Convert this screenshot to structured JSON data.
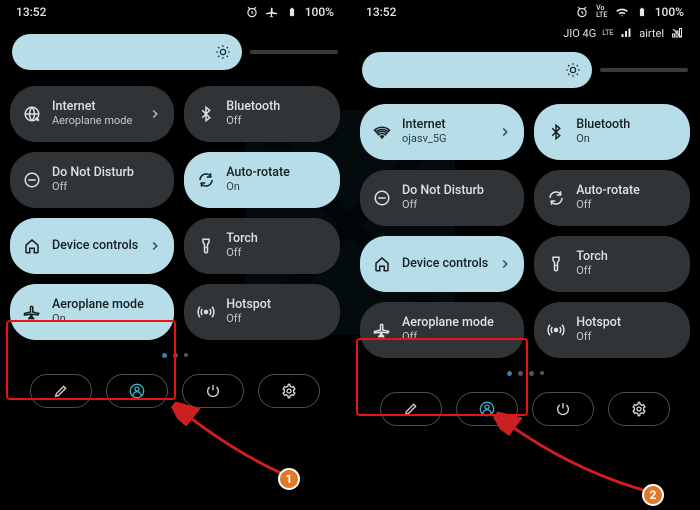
{
  "colors": {
    "tile_on": "#b6dde8",
    "tile_off": "#303437",
    "accent": "#33b5cc",
    "highlight": "#e11",
    "badge": "#e07a2a"
  },
  "left": {
    "status": {
      "time": "13:52",
      "battery": "100%"
    },
    "tiles": [
      {
        "icon": "globe",
        "label": "Internet",
        "sub": "Aeroplane mode",
        "state": "off",
        "chev": true
      },
      {
        "icon": "bluetooth",
        "label": "Bluetooth",
        "sub": "Off",
        "state": "off",
        "chev": false
      },
      {
        "icon": "dnd",
        "label": "Do Not Disturb",
        "sub": "Off",
        "state": "off",
        "chev": false
      },
      {
        "icon": "rotate",
        "label": "Auto-rotate",
        "sub": "On",
        "state": "on",
        "chev": false
      },
      {
        "icon": "home",
        "label": "Device controls",
        "sub": "",
        "state": "on",
        "chev": true
      },
      {
        "icon": "torch",
        "label": "Torch",
        "sub": "Off",
        "state": "off",
        "chev": false
      },
      {
        "icon": "plane",
        "label": "Aeroplane mode",
        "sub": "On",
        "state": "on",
        "chev": false
      },
      {
        "icon": "hotspot",
        "label": "Hotspot",
        "sub": "Off",
        "state": "off",
        "chev": false
      }
    ],
    "badge": "1"
  },
  "right": {
    "status": {
      "time": "13:52",
      "battery": "100%"
    },
    "carrier": {
      "left_net": "JIO 4G",
      "lte": "LTE",
      "right_net": "airtel"
    },
    "tiles": [
      {
        "icon": "wifi",
        "label": "Internet",
        "sub": "ojasv_5G",
        "state": "on",
        "chev": true
      },
      {
        "icon": "bluetooth",
        "label": "Bluetooth",
        "sub": "On",
        "state": "on",
        "chev": false
      },
      {
        "icon": "dnd",
        "label": "Do Not Disturb",
        "sub": "Off",
        "state": "off",
        "chev": false
      },
      {
        "icon": "rotate",
        "label": "Auto-rotate",
        "sub": "Off",
        "state": "off",
        "chev": false
      },
      {
        "icon": "home",
        "label": "Device controls",
        "sub": "",
        "state": "on",
        "chev": true
      },
      {
        "icon": "torch",
        "label": "Torch",
        "sub": "Off",
        "state": "off",
        "chev": false
      },
      {
        "icon": "plane",
        "label": "Aeroplane mode",
        "sub": "Off",
        "state": "off",
        "chev": false
      },
      {
        "icon": "hotspot",
        "label": "Hotspot",
        "sub": "Off",
        "state": "off",
        "chev": false
      }
    ],
    "badge": "2"
  }
}
